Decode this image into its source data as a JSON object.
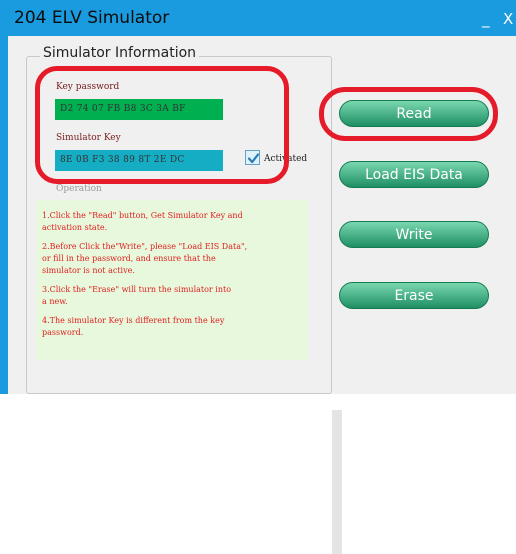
{
  "window": {
    "title": "204 ELV Simulator",
    "minimize_glyph": "_",
    "close_glyph": "X"
  },
  "group": {
    "title": "Simulator Information"
  },
  "key_password": {
    "label": "Key password",
    "value": "D2  74  07  FB  B8  3C  3A  BF"
  },
  "simulator_key": {
    "label": "Simulator Key",
    "value": "8E  0B  F3  38  89  8T  2E  DC"
  },
  "activated": {
    "label": "Activated",
    "checked": true
  },
  "operation": {
    "label": "Operation"
  },
  "instructions": [
    "1.Click the \"Read\" button, Get Simulator Key and\n   activation state.",
    "2.Before Click the\"Write\", please \"Load EIS Data\",\n   or fill in the password, and ensure that the\n   simulator is not active.",
    "3.Click the \"Erase\" will turn the simulator into\n   a new.",
    "4.The simulator Key is different from the key\n   password."
  ],
  "buttons": {
    "read": "Read",
    "load": "Load EIS Data",
    "write": "Write",
    "erase": "Erase"
  },
  "colors": {
    "title_bar": "#1a9be0",
    "key_password_field": "#00b050",
    "simulator_key_field": "#15adc4",
    "button": "#2aa275",
    "highlight": "#e61b2a",
    "instructions_bg": "#e8f8dc",
    "instructions_text": "#e02020"
  }
}
